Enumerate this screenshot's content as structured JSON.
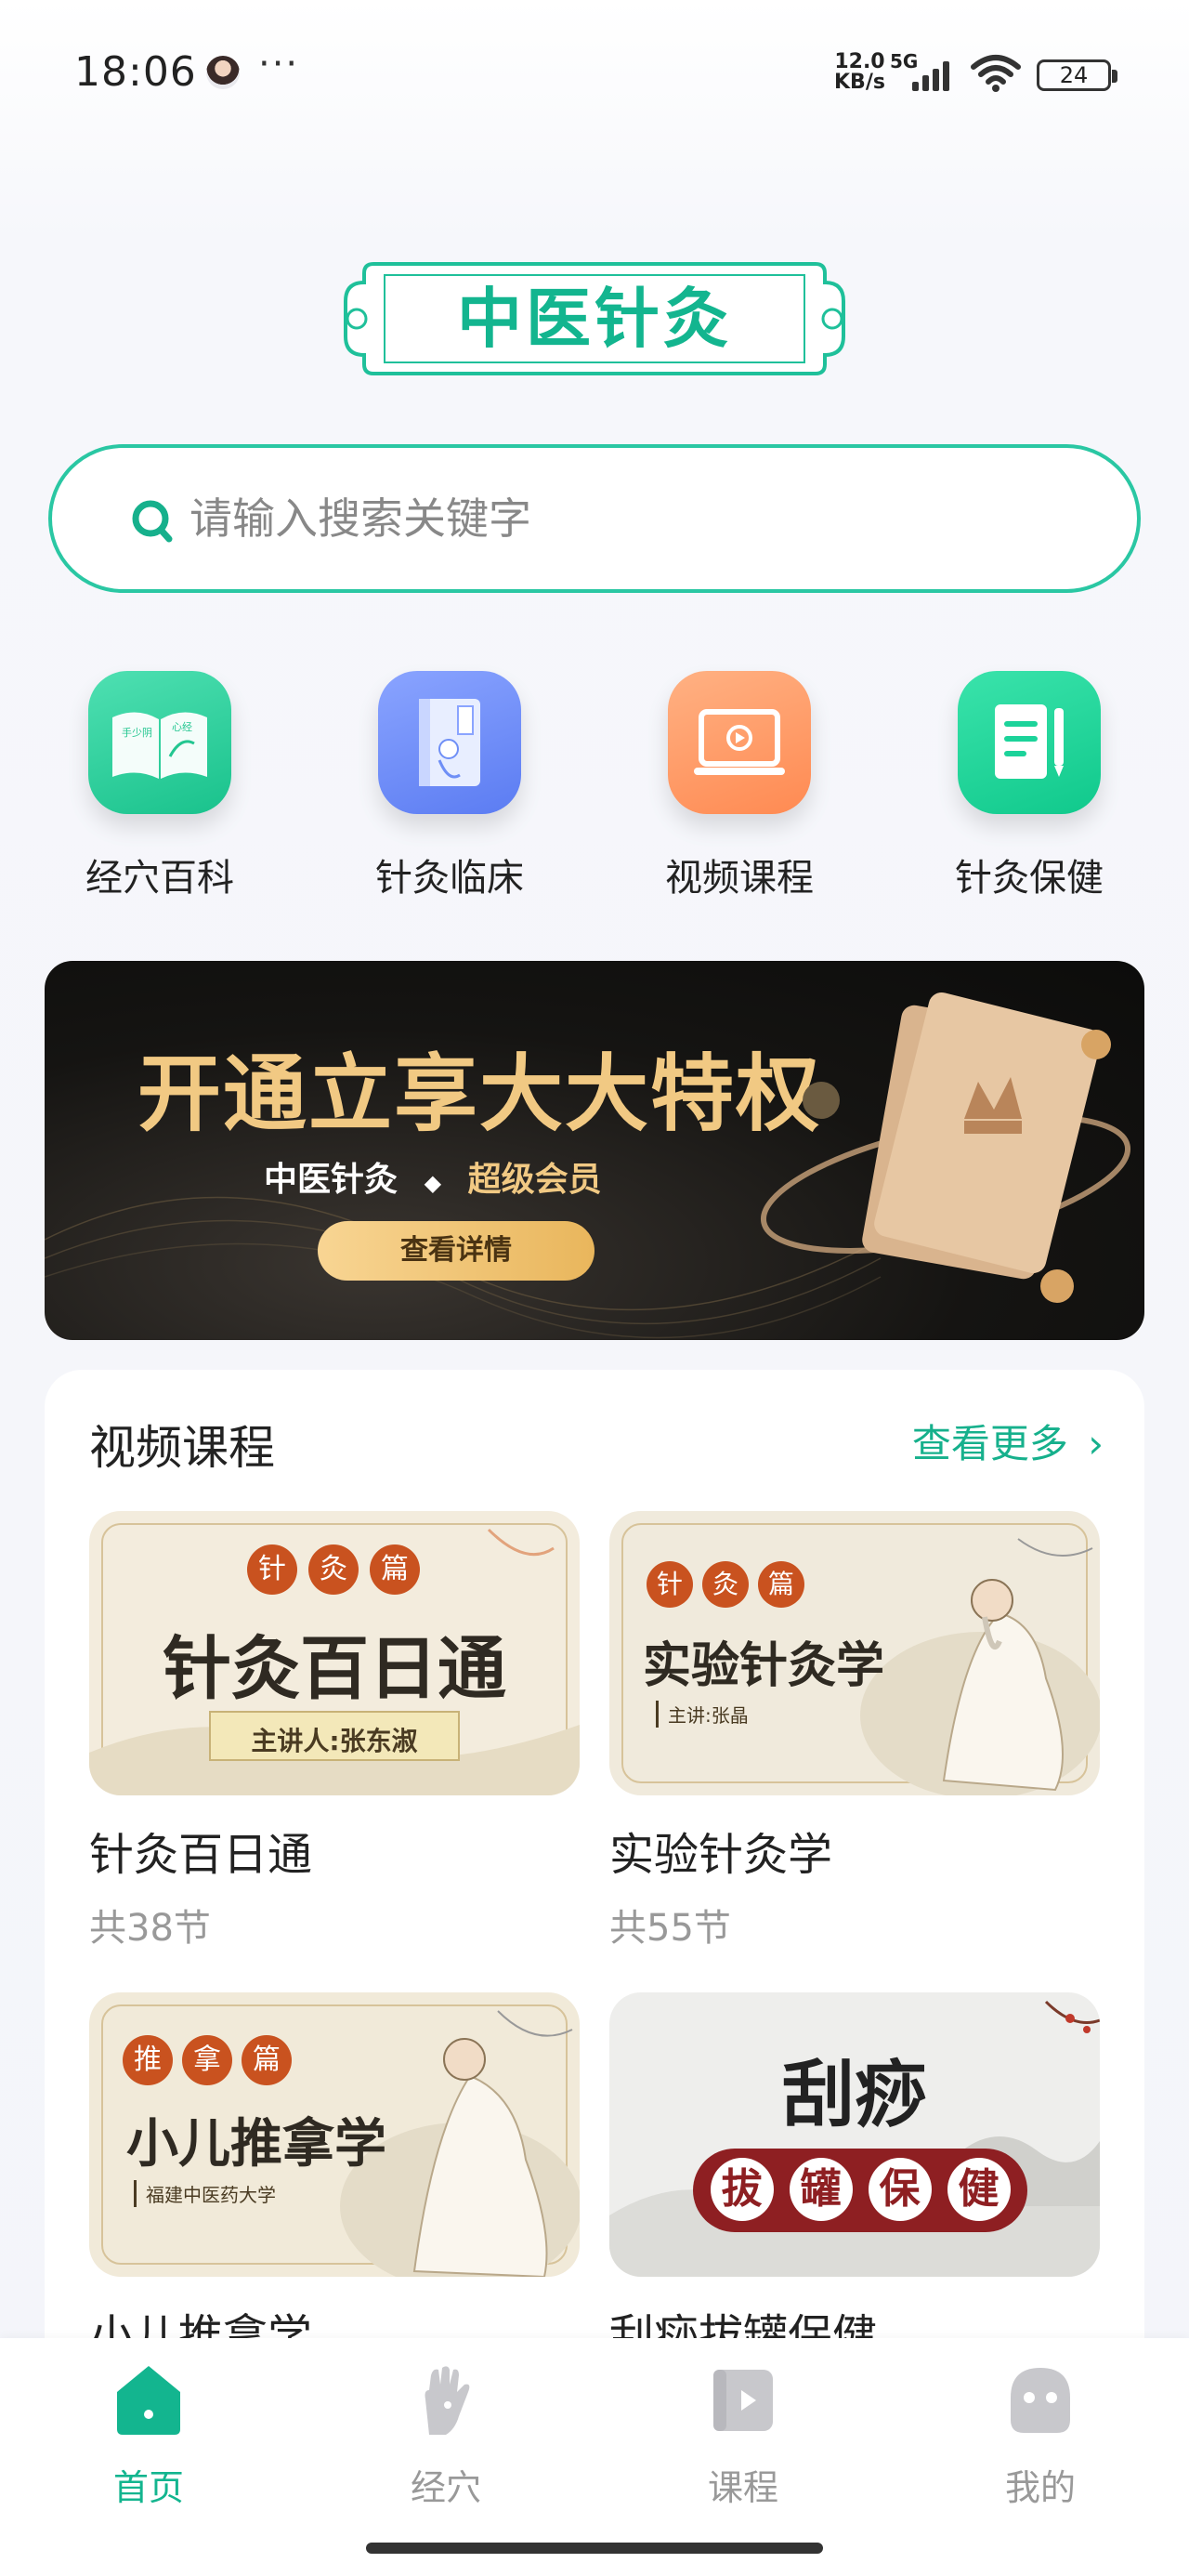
{
  "status_bar": {
    "time": "18:06",
    "dots": "···",
    "speed_value": "12.0",
    "speed_unit": "KB/s",
    "network": "5G",
    "battery": "24"
  },
  "app": {
    "title": "中医针灸",
    "accent": "#13b58f"
  },
  "search": {
    "placeholder": "请输入搜索关键字"
  },
  "quick_nav": [
    {
      "label": "经穴百科",
      "icon": "book-icon",
      "color": "#2fd39e"
    },
    {
      "label": "针灸临床",
      "icon": "medical-book-icon",
      "color": "#6f8ff6"
    },
    {
      "label": "视频课程",
      "icon": "video-laptop-icon",
      "color": "#ff9a66"
    },
    {
      "label": "针灸保健",
      "icon": "notebook-pen-icon",
      "color": "#1cd39a"
    }
  ],
  "banner": {
    "title": "开通立享大大特权",
    "subtitle_left": "中医针灸",
    "subtitle_sep": "◆",
    "subtitle_right": "超级会员",
    "button": "查看详情"
  },
  "video_section": {
    "title": "视频课程",
    "more": "查看更多",
    "courses": [
      {
        "name": "针灸百日通",
        "count": "共38节",
        "tag": [
          "针",
          "灸",
          "篇"
        ],
        "thumb_title": "针灸百日通",
        "thumb_sub": "主讲人:张东淑"
      },
      {
        "name": "实验针灸学",
        "count": "共55节",
        "tag": [
          "针",
          "灸",
          "篇"
        ],
        "thumb_title": "实验针灸学",
        "thumb_sub": "主讲:张晶"
      },
      {
        "name": "小儿推拿学",
        "count": "",
        "tag": [
          "推",
          "拿",
          "篇"
        ],
        "thumb_title": "小儿推拿学",
        "thumb_sub": "福建中医药大学"
      },
      {
        "name": "刮痧拔罐保健",
        "count": "",
        "thumb_title_top": "刮痧",
        "thumb_chars": [
          "拔",
          "罐",
          "保",
          "健"
        ]
      }
    ]
  },
  "tabbar": [
    {
      "label": "首页",
      "icon": "home-icon",
      "active": true
    },
    {
      "label": "经穴",
      "icon": "hand-acupoint-icon",
      "active": false
    },
    {
      "label": "课程",
      "icon": "course-icon",
      "active": false
    },
    {
      "label": "我的",
      "icon": "profile-icon",
      "active": false
    }
  ]
}
